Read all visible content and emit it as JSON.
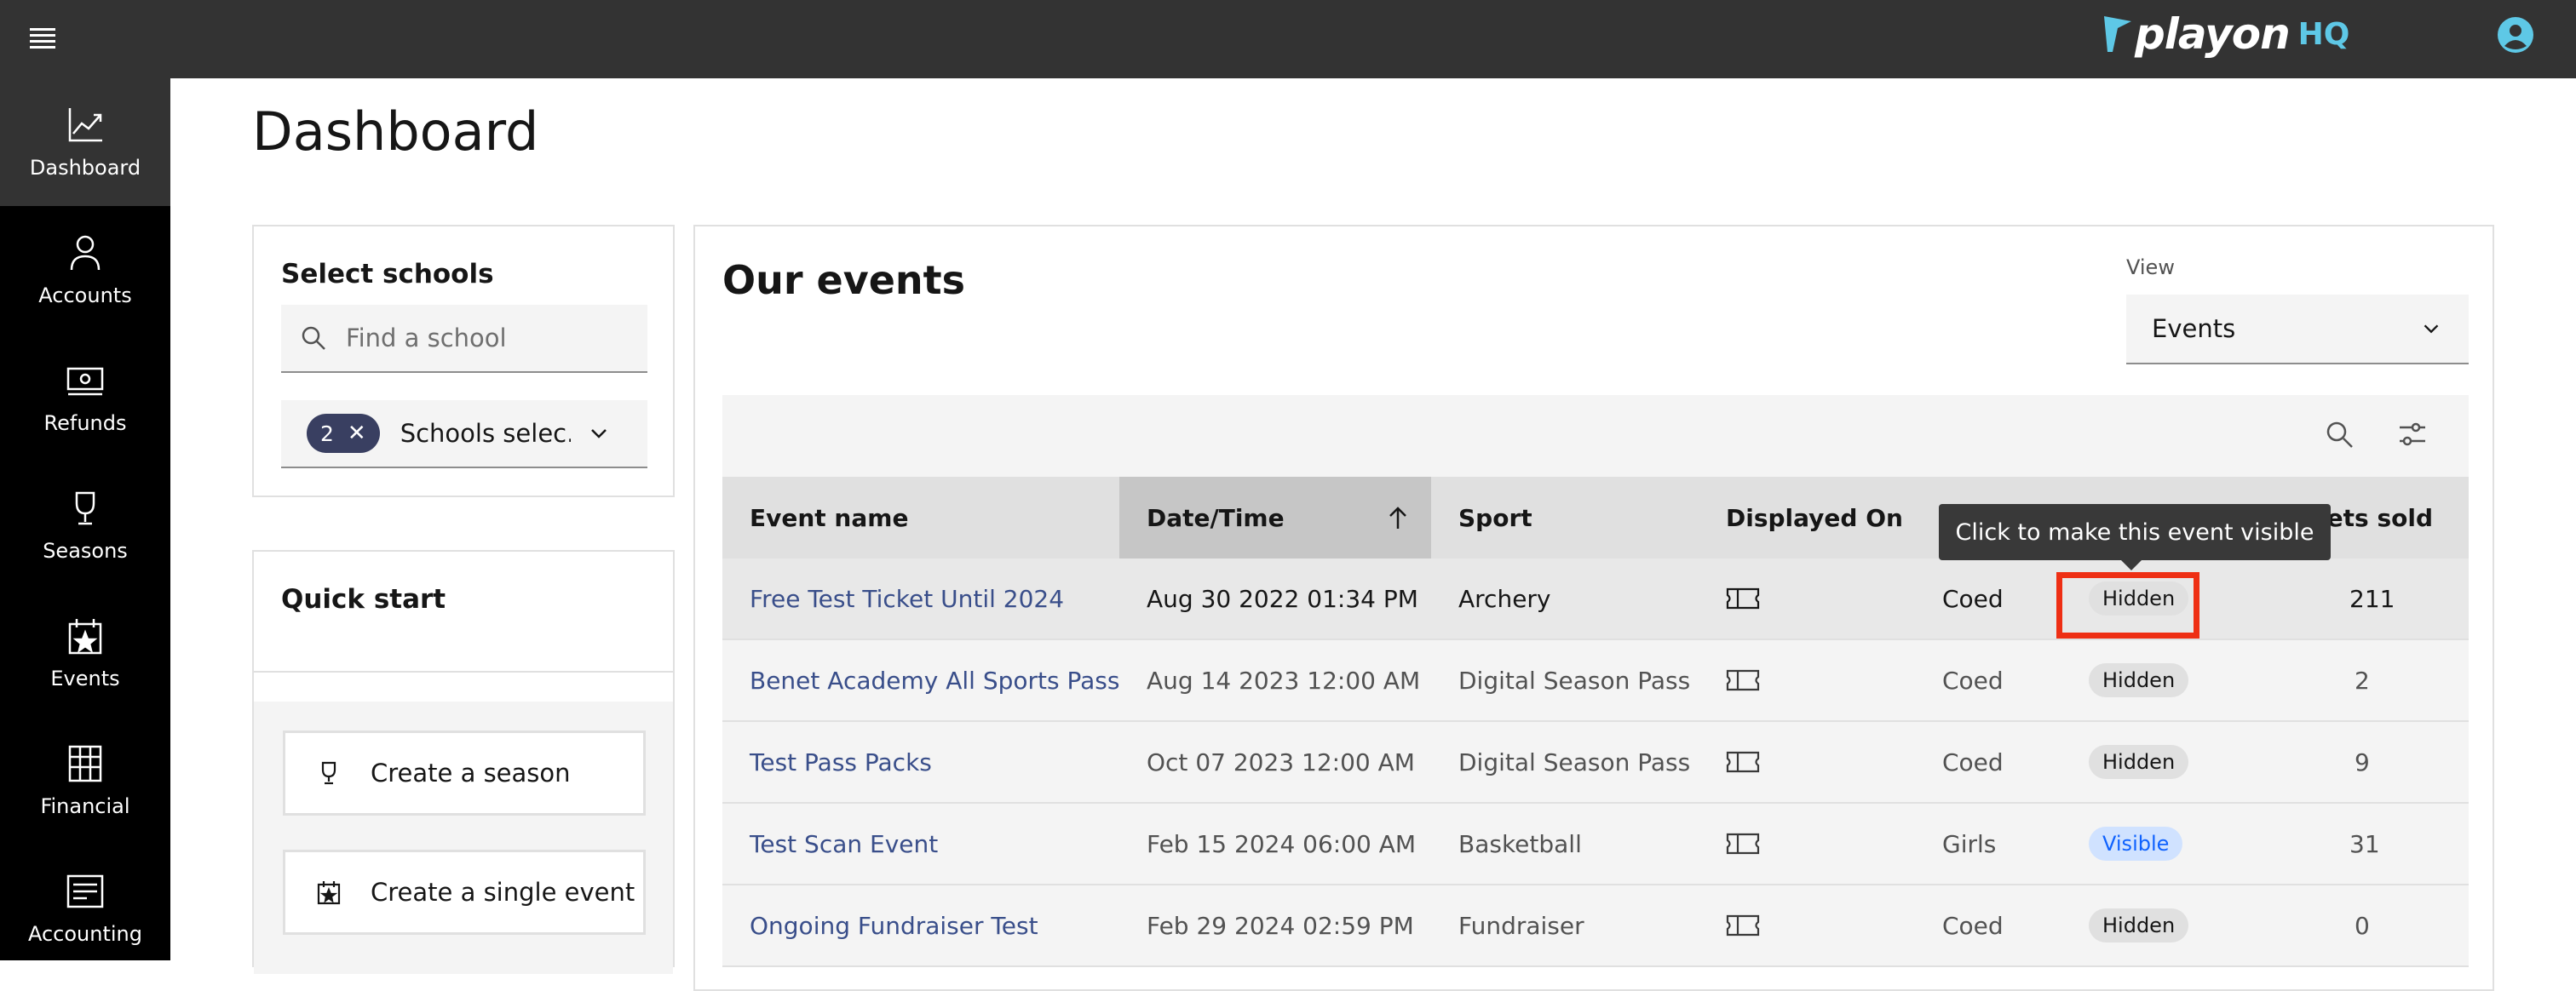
{
  "app": {
    "brand_word": "playon",
    "brand_suffix": "HQ"
  },
  "sidebar": {
    "items": [
      {
        "label": "Dashboard",
        "icon": "chart-icon",
        "active": true
      },
      {
        "label": "Accounts",
        "icon": "user-icon"
      },
      {
        "label": "Refunds",
        "icon": "money-icon"
      },
      {
        "label": "Seasons",
        "icon": "trophy-icon"
      },
      {
        "label": "Events",
        "icon": "calendar-star-icon"
      },
      {
        "label": "Financial",
        "icon": "table-icon"
      },
      {
        "label": "Accounting",
        "icon": "receipt-icon"
      }
    ]
  },
  "page": {
    "title": "Dashboard"
  },
  "schools": {
    "title": "Select schools",
    "search_placeholder": "Find a school",
    "selected_count": "2",
    "select_label": "Schools selec..."
  },
  "quick_start": {
    "title": "Quick start",
    "buttons": [
      {
        "label": "Create a season",
        "icon": "trophy-icon"
      },
      {
        "label": "Create a single event",
        "icon": "calendar-star-icon"
      }
    ]
  },
  "events": {
    "title": "Our events",
    "view_label": "View",
    "view_value": "Events",
    "columns": [
      "Event name",
      "Date/Time",
      "Sport",
      "Displayed On",
      "",
      "",
      "Tickets sold"
    ],
    "tickets_col_visible": "kets sold",
    "rows": [
      {
        "name": "Free Test Ticket Until 2024",
        "date": "Aug 30 2022 01:34 PM",
        "sport": "Archery",
        "gender": "Coed",
        "status": "Hidden",
        "sold": "211"
      },
      {
        "name": "Benet Academy All Sports Pass",
        "date": "Aug 14 2023 12:00 AM",
        "sport": "Digital Season Pass",
        "gender": "Coed",
        "status": "Hidden",
        "sold": "2"
      },
      {
        "name": "Test Pass Packs",
        "date": "Oct 07 2023 12:00 AM",
        "sport": "Digital Season Pass",
        "gender": "Coed",
        "status": "Hidden",
        "sold": "9"
      },
      {
        "name": "Test Scan Event",
        "date": "Feb 15 2024 06:00 AM",
        "sport": "Basketball",
        "gender": "Girls",
        "status": "Visible",
        "sold": "31"
      },
      {
        "name": "Ongoing Fundraiser Test",
        "date": "Feb 29 2024 02:59 PM",
        "sport": "Fundraiser",
        "gender": "Coed",
        "status": "Hidden",
        "sold": "0"
      }
    ],
    "tooltip": "Click to make this event visible"
  },
  "colors": {
    "accent_link": "#394e8a",
    "highlight": "#ee2f14",
    "visible_badge": "#0f62fe",
    "brand_hq": "#5ec8e6"
  }
}
